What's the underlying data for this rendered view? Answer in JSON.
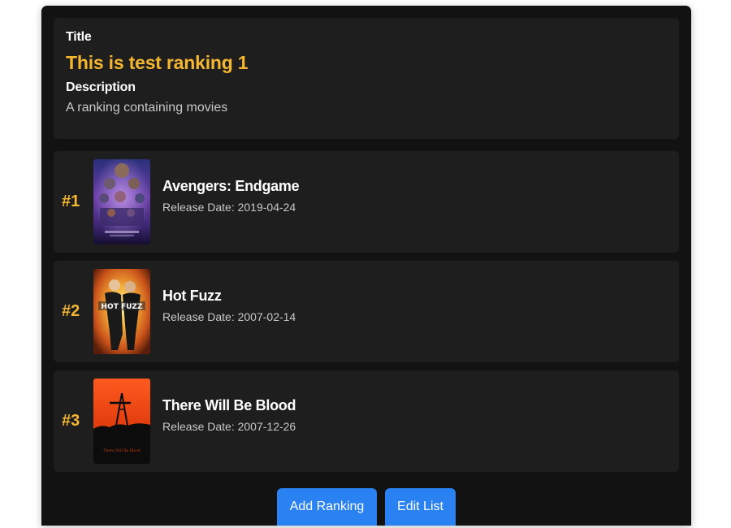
{
  "ranking": {
    "title_label": "Title",
    "title": "This is test ranking 1",
    "description_label": "Description",
    "description": "A ranking containing movies"
  },
  "movies": [
    {
      "rank": "#1",
      "title": "Avengers: Endgame",
      "release": "Release Date: 2019-04-24",
      "poster": "avengers-endgame-poster"
    },
    {
      "rank": "#2",
      "title": "Hot Fuzz",
      "release": "Release Date: 2007-02-14",
      "poster": "hot-fuzz-poster",
      "poster_text": "HOT FUZZ"
    },
    {
      "rank": "#3",
      "title": "There Will Be Blood",
      "release": "Release Date: 2007-12-26",
      "poster": "there-will-be-blood-poster",
      "poster_text": "There Will Be Blood"
    }
  ],
  "actions": {
    "add_label": "Add Ranking",
    "edit_label": "Edit List"
  },
  "colors": {
    "accent": "#f5b731",
    "panel": "#121212",
    "card": "#1e1e1e",
    "button": "#2a82f2"
  }
}
